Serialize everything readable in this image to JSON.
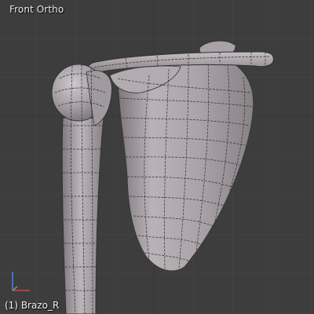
{
  "viewport": {
    "view_name": "Front Ortho",
    "object_info": "(1) Brazo_R"
  },
  "colors": {
    "background": "#3d3d3d",
    "grid_line": "#474747",
    "grid_axis": "#353535",
    "mesh_fill_light": "#b8b2b6",
    "mesh_fill_mid": "#9f999d",
    "mesh_fill_dark": "#7f797d",
    "wire": "#2a2a2a",
    "axis_x": "#e04040",
    "axis_y": "#40c040",
    "axis_z": "#4080ff"
  },
  "icons": {
    "axis_gizmo": "axis-gizmo-icon"
  },
  "model": {
    "parts": [
      "scapula",
      "clavicle",
      "humerus"
    ]
  }
}
